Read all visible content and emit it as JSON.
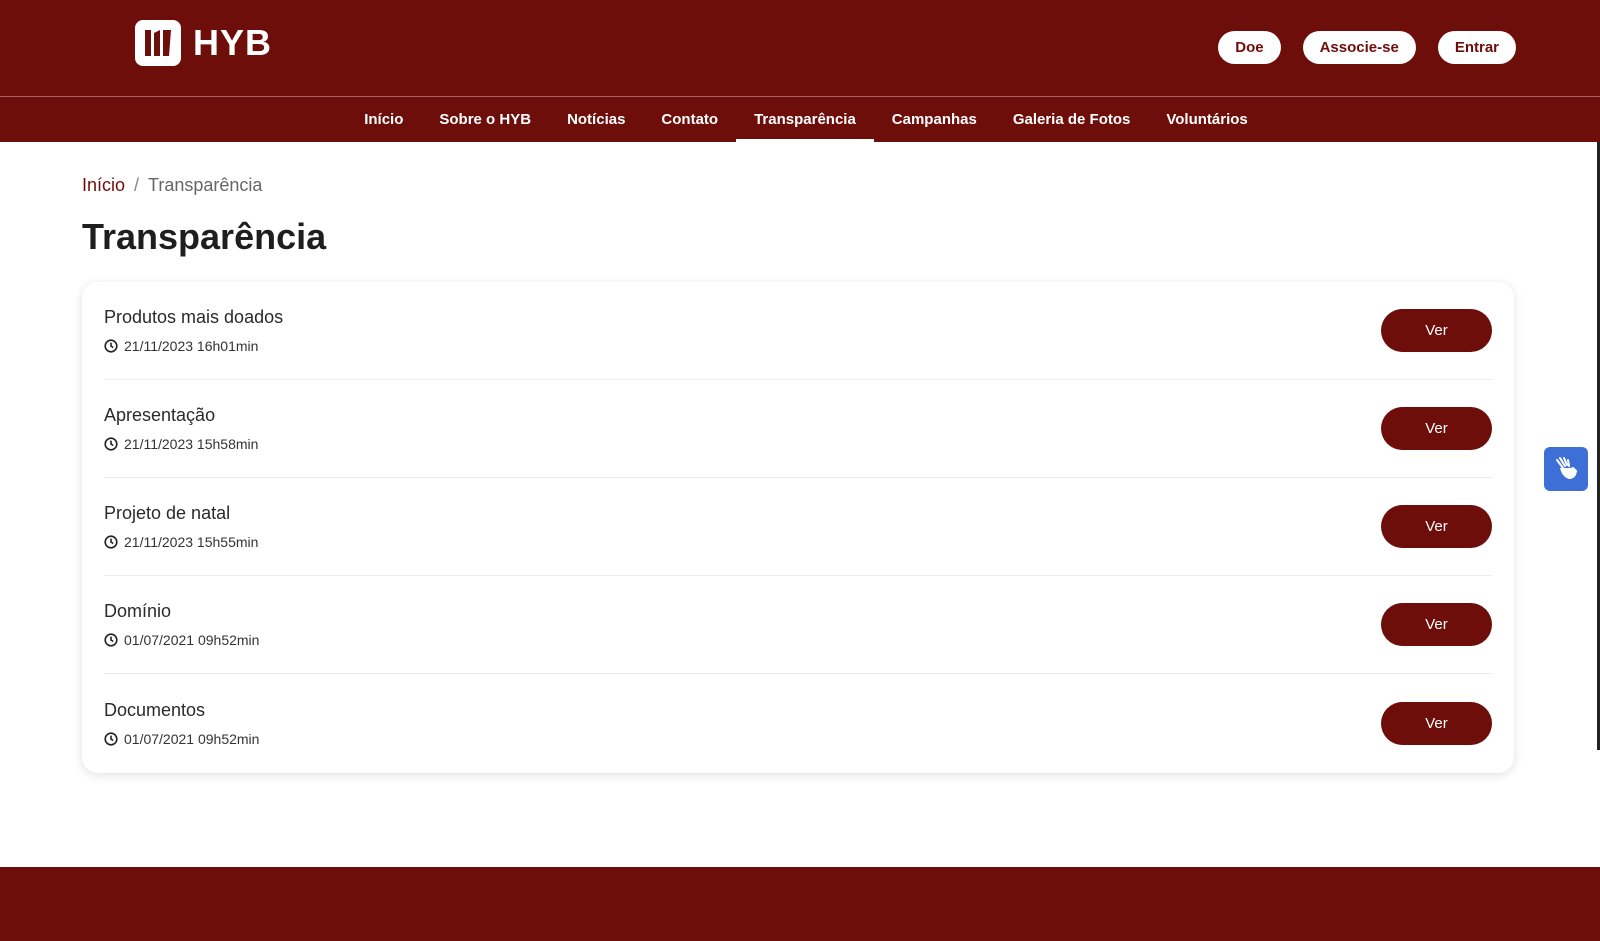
{
  "brand": {
    "name": "HYB"
  },
  "header": {
    "actions": [
      {
        "label": "Doe"
      },
      {
        "label": "Associe-se"
      },
      {
        "label": "Entrar"
      }
    ]
  },
  "nav": {
    "items": [
      {
        "label": "Início"
      },
      {
        "label": "Sobre o HYB"
      },
      {
        "label": "Notícias"
      },
      {
        "label": "Contato"
      },
      {
        "label": "Transparência",
        "active": true
      },
      {
        "label": "Campanhas"
      },
      {
        "label": "Galeria de Fotos"
      },
      {
        "label": "Voluntários"
      }
    ]
  },
  "breadcrumb": {
    "home": "Início",
    "separator": "/",
    "current": "Transparência"
  },
  "page": {
    "title": "Transparência"
  },
  "documents": [
    {
      "title": "Produtos mais doados",
      "date": "21/11/2023 16h01min",
      "action": "Ver"
    },
    {
      "title": "Apresentação",
      "date": "21/11/2023 15h58min",
      "action": "Ver"
    },
    {
      "title": "Projeto de natal",
      "date": "21/11/2023 15h55min",
      "action": "Ver"
    },
    {
      "title": "Domínio",
      "date": "01/07/2021 09h52min",
      "action": "Ver"
    },
    {
      "title": "Documentos",
      "date": "01/07/2021 09h52min",
      "action": "Ver"
    }
  ],
  "colors": {
    "brand": "#6e0e0a",
    "accessibility": "#3d6fd6"
  },
  "icons": {
    "clock": "clock-icon",
    "accessibility": "sign-language-icon"
  }
}
